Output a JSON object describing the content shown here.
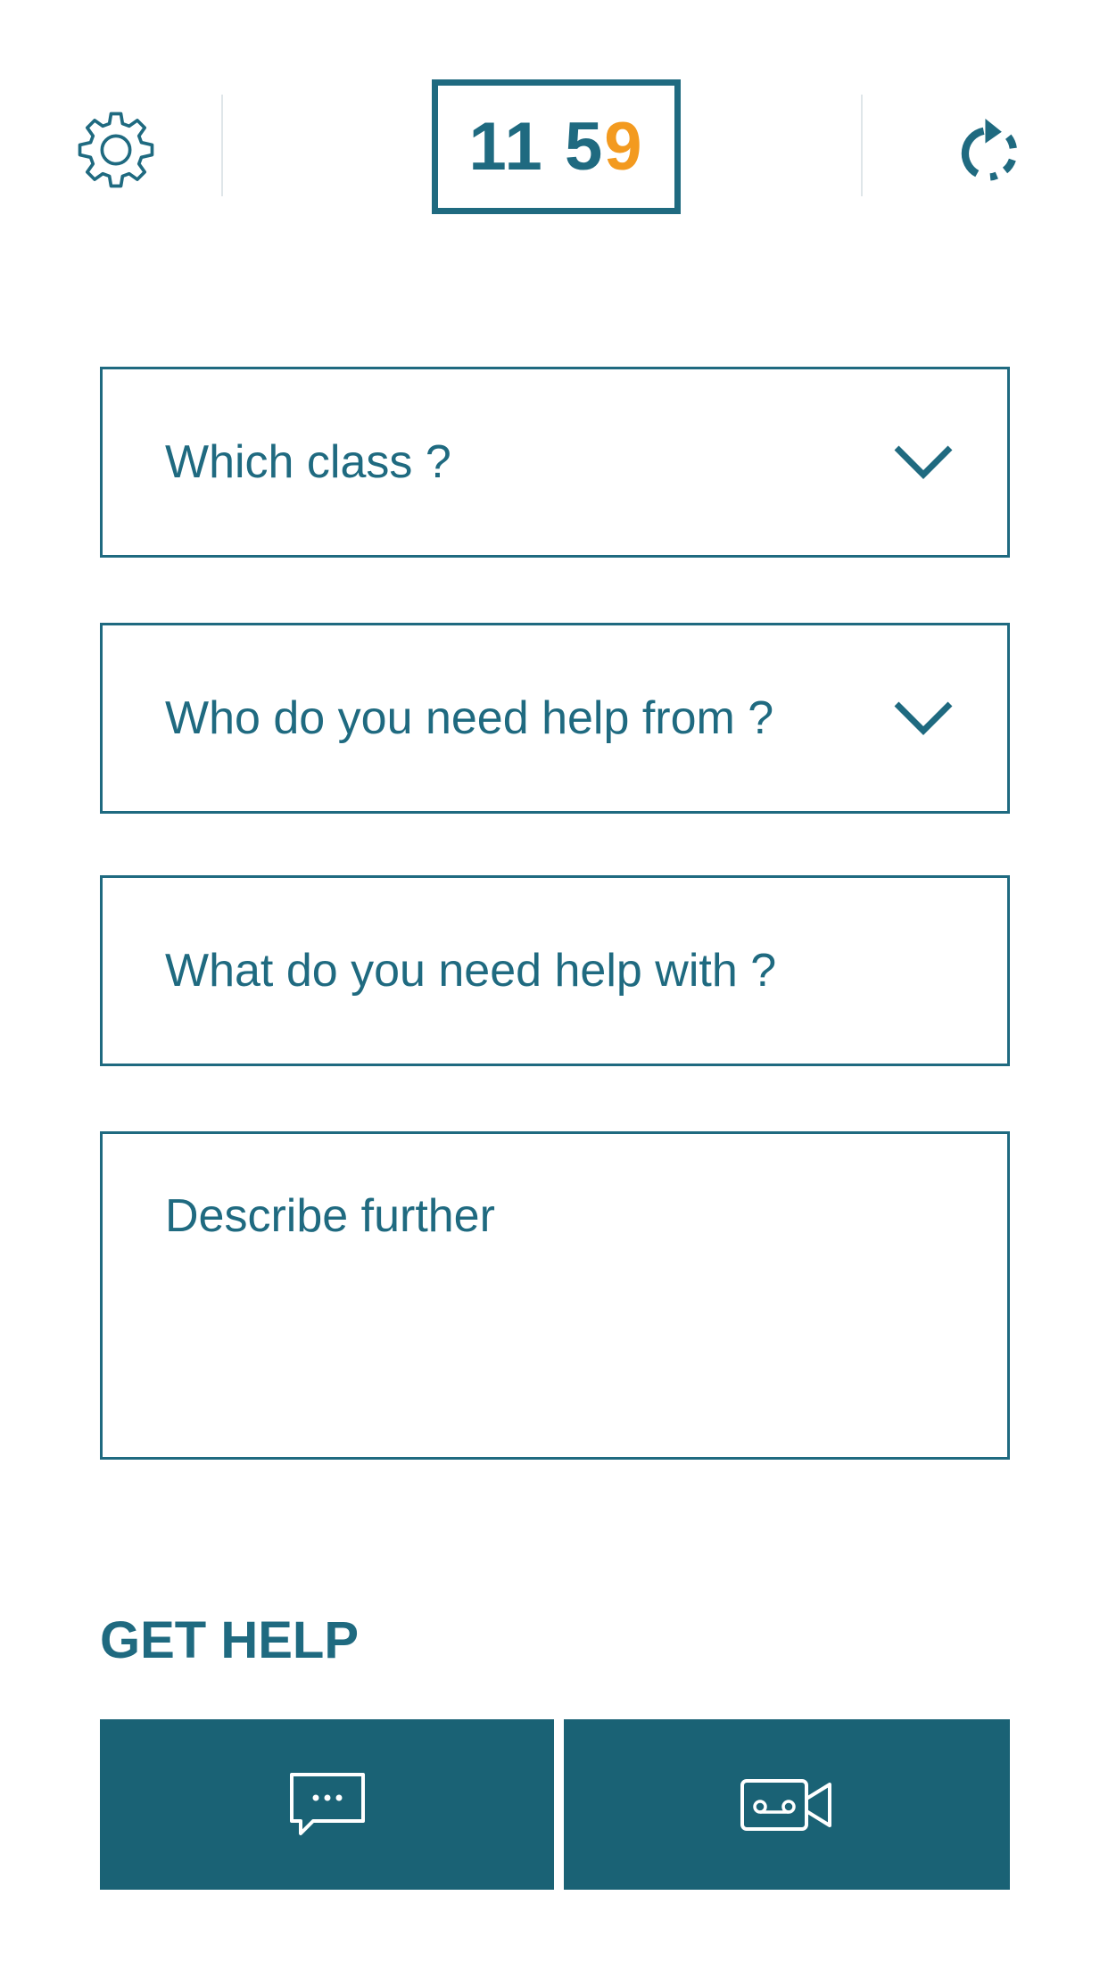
{
  "header": {
    "logo_part1": "11 5",
    "logo_part2": "9",
    "icons": {
      "left": "gear-icon",
      "right": "refresh-icon"
    }
  },
  "form": {
    "class_select": {
      "label": "Which class ?",
      "icon": "chevron-down-icon"
    },
    "helper_select": {
      "label": "Who do you need help from ?",
      "icon": "chevron-down-icon"
    },
    "topic_input": {
      "label": "What do you need help with ?"
    },
    "description_input": {
      "label": "Describe further"
    }
  },
  "get_help": {
    "title": "GET HELP",
    "buttons": [
      {
        "icon": "chat-bubble-icon"
      },
      {
        "icon": "video-camera-icon"
      }
    ]
  },
  "colors": {
    "primary": "#1f6a80",
    "button_bg": "#1a6275",
    "accent": "#f39a1f",
    "divider": "#dfe6e9"
  }
}
